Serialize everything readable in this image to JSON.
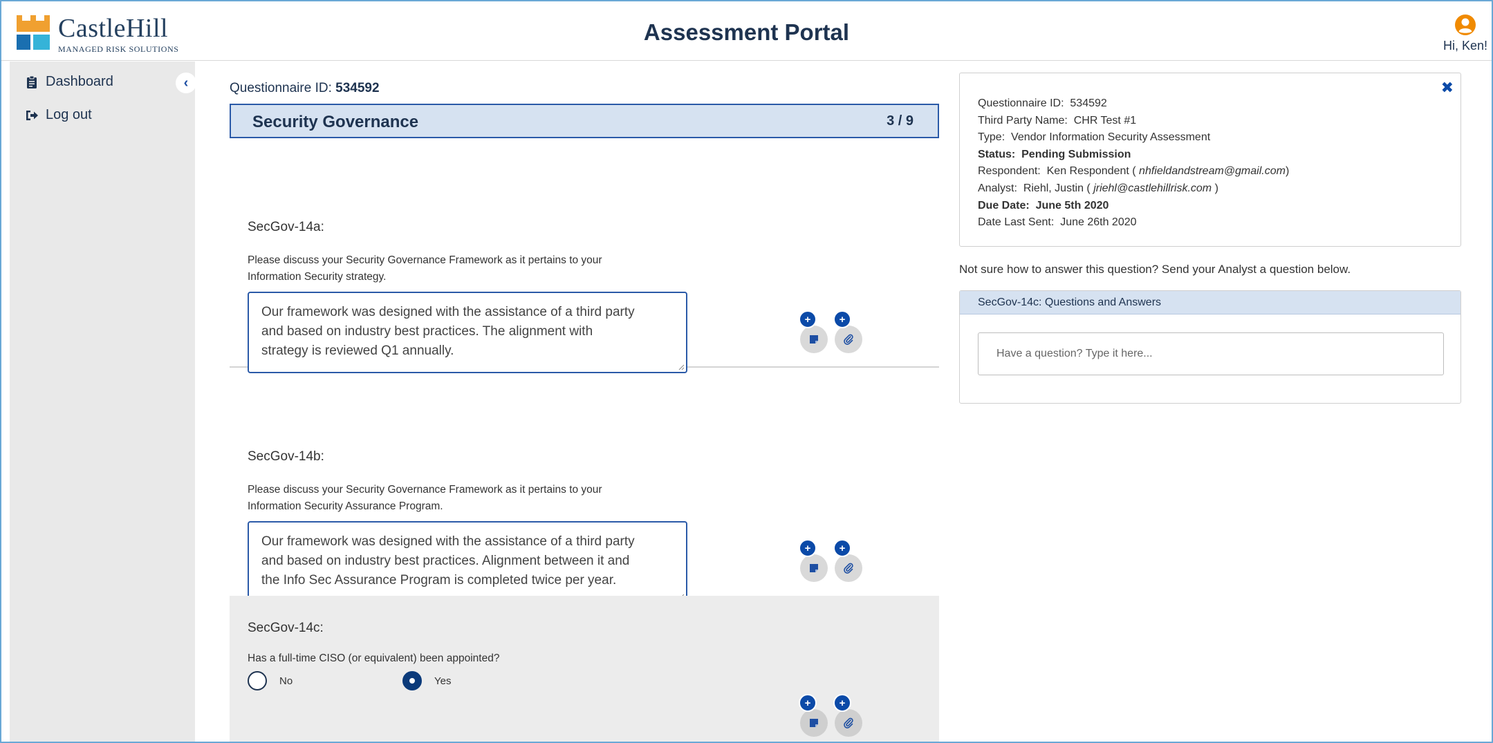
{
  "header": {
    "logo_name": "CastleHill",
    "logo_tagline": "MANAGED RISK SOLUTIONS",
    "portal_title": "Assessment Portal",
    "greeting": "Hi, Ken!"
  },
  "sidebar": {
    "collapse_glyph": "‹",
    "items": [
      {
        "label": "Dashboard",
        "icon": "clipboard-icon"
      },
      {
        "label": "Log out",
        "icon": "sign-out-icon"
      }
    ]
  },
  "main": {
    "questionnaire_label": "Questionnaire ID:",
    "questionnaire_id": "534592",
    "section_title": "Security Governance",
    "section_progress": "3 / 9",
    "questions": [
      {
        "id": "SecGov-14a:",
        "text_line1": "Please discuss your Security Governance Framework as it pertains to your",
        "text_line2": "Information Security strategy.",
        "answer_line1": "Our framework was designed with the assistance of a third party",
        "answer_line2": "and  based on industry best practices. The alignment with",
        "answer_line3": "strategy is reviewed Q1 annually."
      },
      {
        "id": "SecGov-14b:",
        "text_line1": "Please discuss your Security Governance Framework as it pertains to your",
        "text_line2": "Information Security Assurance Program.",
        "answer_line1": "Our framework was designed with the assistance of a third party",
        "answer_line2": "and  based on industry best practices. Alignment between it and",
        "answer_line3": "the Info Sec Assurance Program is completed twice per year."
      },
      {
        "id": "SecGov-14c:",
        "text": "Has a full-time CISO (or equivalent) been appointed?",
        "option_no": "No",
        "option_yes": "Yes",
        "selected": "Yes"
      }
    ],
    "plus_glyph": "+"
  },
  "info": {
    "close_glyph": "✖",
    "qid_label": "Questionnaire ID:",
    "qid": "534592",
    "third_party_label": "Third Party Name:",
    "third_party": "CHR Test #1",
    "type_label": "Type:",
    "type": "Vendor Information Security Assessment",
    "status_label": "Status:",
    "status": "Pending Submission",
    "respondent_label": "Respondent:",
    "respondent_name": "Ken Respondent",
    "respondent_email": "nhfieldandstream@gmail.com",
    "analyst_label": "Analyst:",
    "analyst_name": "Riehl, Justin",
    "analyst_email": "jriehl@castlehillrisk.com",
    "due_label": "Due Date:",
    "due": "June 5th 2020",
    "last_sent_label": "Date Last Sent:",
    "last_sent": "June 26th 2020"
  },
  "help": {
    "text": "Not sure how to answer this question? Send your Analyst a question below.",
    "qa_title": "SecGov-14c: Questions and Answers",
    "qa_placeholder": "Have a question? Type it here..."
  },
  "colors": {
    "accent": "#0b4aa8",
    "section_bg": "#d6e2f1",
    "sidebar_bg": "#e9e9e9",
    "logo_orange": "#f0a030",
    "logo_blue": "#1a6fb0",
    "logo_cyan": "#35b3d8"
  }
}
